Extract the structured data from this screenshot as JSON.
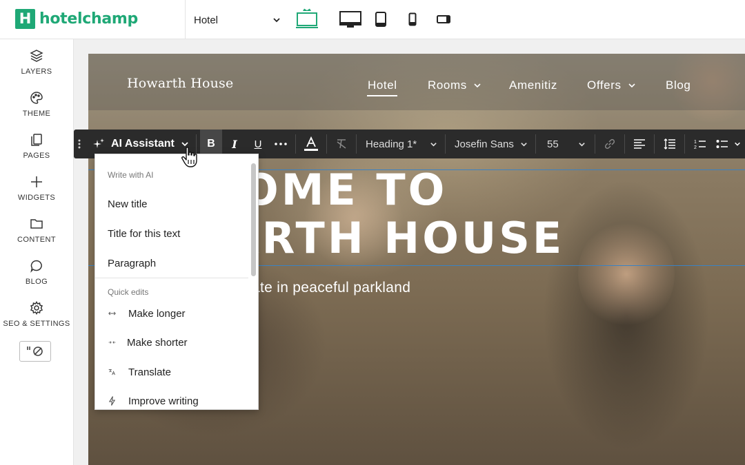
{
  "brand": {
    "logo_letter": "H",
    "name": "hotelchamp",
    "color": "#1fa876"
  },
  "topbar": {
    "site_select": "Hotel",
    "devices": [
      "desktop-preview-icon",
      "desktop-icon",
      "tablet-icon",
      "mobile-icon",
      "mobile-landscape-icon"
    ],
    "active_device_color": "#1fa876"
  },
  "sidebar": {
    "items": [
      {
        "label": "LAYERS",
        "icon": "layers-icon"
      },
      {
        "label": "THEME",
        "icon": "palette-icon"
      },
      {
        "label": "PAGES",
        "icon": "pages-icon"
      },
      {
        "label": "WIDGETS",
        "icon": "plus-icon"
      },
      {
        "label": "CONTENT",
        "icon": "folder-icon"
      },
      {
        "label": "BLOG",
        "icon": "chat-bubble-icon"
      },
      {
        "label": "SEO & SETTINGS",
        "icon": "gear-icon"
      }
    ],
    "toggle_icon": "no-code-toggle-icon"
  },
  "site": {
    "brand": "Howarth House",
    "nav": [
      {
        "label": "Hotel",
        "dropdown": false,
        "active": true
      },
      {
        "label": "Rooms",
        "dropdown": true,
        "active": false
      },
      {
        "label": "Amenitiz",
        "dropdown": false,
        "active": false
      },
      {
        "label": "Offers",
        "dropdown": true,
        "active": false
      },
      {
        "label": "Blog",
        "dropdown": false,
        "active": false
      }
    ],
    "hero_title": "LCOME TO\nWARTH HOUSE",
    "hero_subtitle": "ate in peaceful parkland"
  },
  "toolbar": {
    "ai_label": "AI Assistant",
    "style_select": "Heading 1*",
    "font_select": "Josefin Sans",
    "size_select": "55"
  },
  "ai_menu": {
    "write_section": "Write with AI",
    "write_items": [
      "New title",
      "Title for this text",
      "Paragraph"
    ],
    "quick_section": "Quick edits",
    "quick_items": [
      {
        "label": "Make longer",
        "icon": "expand-arrows-icon"
      },
      {
        "label": "Make shorter",
        "icon": "collapse-arrows-icon"
      },
      {
        "label": "Translate",
        "icon": "translate-icon"
      },
      {
        "label": "Improve writing",
        "icon": "lightning-icon"
      }
    ]
  }
}
